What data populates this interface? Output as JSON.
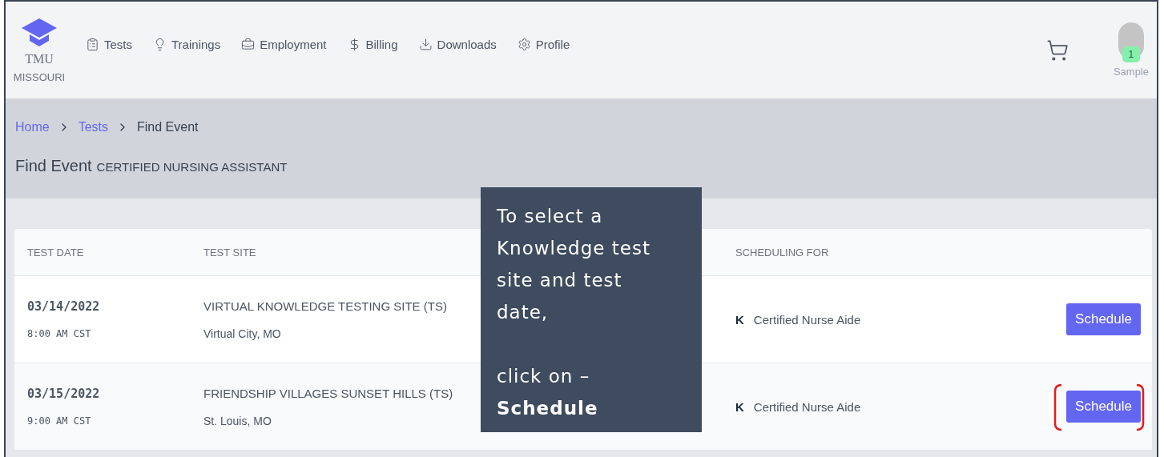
{
  "brand": {
    "title": "TMU",
    "subtitle": "MISSOURI"
  },
  "nav": [
    {
      "label": "Tests"
    },
    {
      "label": "Trainings"
    },
    {
      "label": "Employment"
    },
    {
      "label": "Billing"
    },
    {
      "label": "Downloads"
    },
    {
      "label": "Profile"
    }
  ],
  "user": {
    "name": "Sample",
    "badge": "1"
  },
  "breadcrumb": [
    {
      "label": "Home",
      "link": true
    },
    {
      "label": "Tests",
      "link": true
    },
    {
      "label": "Find Event",
      "link": false
    }
  ],
  "page_title": {
    "title": "Find Event",
    "subtitle": "CERTIFIED NURSING ASSISTANT"
  },
  "table": {
    "columns": [
      "TEST DATE",
      "TEST SITE",
      "SCHEDULING FOR"
    ],
    "rows": [
      {
        "date": "03/14/2022",
        "time": "8:00 AM CST",
        "site": "VIRTUAL KNOWLEDGE TESTING SITE (TS)",
        "location": "Virtual City, MO",
        "code": "K",
        "program": "Certified Nurse Aide",
        "button": "Schedule",
        "highlighted": false
      },
      {
        "date": "03/15/2022",
        "time": "9:00 AM CST",
        "site": "FRIENDSHIP VILLAGES SUNSET HILLS (TS)",
        "location": "St. Louis, MO",
        "code": "K",
        "program": "Certified Nurse Aide",
        "button": "Schedule",
        "highlighted": true
      }
    ]
  },
  "callout": {
    "text": "To select a Knowledge test site and test date,\n\nclick on – **Schedule**"
  }
}
